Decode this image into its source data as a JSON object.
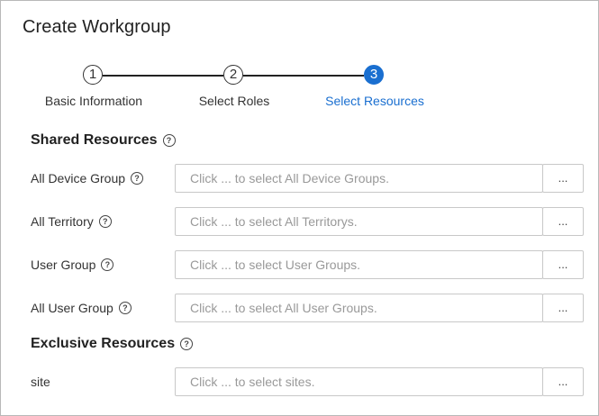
{
  "dialog": {
    "title": "Create Workgroup"
  },
  "stepper": {
    "steps": [
      {
        "number": "1",
        "label": "Basic Information"
      },
      {
        "number": "2",
        "label": "Select Roles"
      },
      {
        "number": "3",
        "label": "Select Resources"
      }
    ],
    "active_step": 3,
    "active_color": "#1a6fd0"
  },
  "shared_resources": {
    "title": "Shared Resources",
    "help_icon": "question-circle-icon",
    "rows": [
      {
        "label": "All Device Group",
        "placeholder": "Click ... to select All Device Groups.",
        "button": "..."
      },
      {
        "label": "All Territory",
        "placeholder": "Click ... to select All Territorys.",
        "button": "..."
      },
      {
        "label": "User Group",
        "placeholder": "Click ... to select User Groups.",
        "button": "..."
      },
      {
        "label": "All User Group",
        "placeholder": "Click ... to select All User Groups.",
        "button": "..."
      }
    ]
  },
  "exclusive_resources": {
    "title": "Exclusive Resources",
    "help_icon": "question-circle-icon",
    "rows": [
      {
        "label": "site",
        "placeholder": "Click ... to select sites.",
        "button": "..."
      }
    ]
  }
}
